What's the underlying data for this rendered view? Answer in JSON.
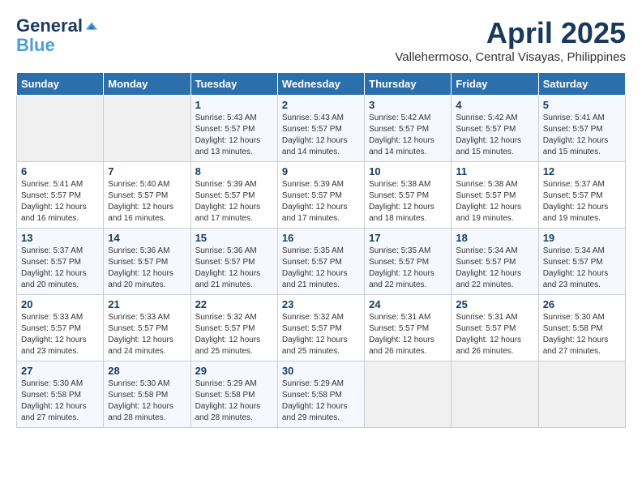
{
  "header": {
    "logo_line1": "General",
    "logo_line2": "Blue",
    "month_title": "April 2025",
    "subtitle": "Vallehermoso, Central Visayas, Philippines"
  },
  "days_of_week": [
    "Sunday",
    "Monday",
    "Tuesday",
    "Wednesday",
    "Thursday",
    "Friday",
    "Saturday"
  ],
  "weeks": [
    [
      {
        "day": "",
        "sunrise": "",
        "sunset": "",
        "daylight": ""
      },
      {
        "day": "",
        "sunrise": "",
        "sunset": "",
        "daylight": ""
      },
      {
        "day": "1",
        "sunrise": "Sunrise: 5:43 AM",
        "sunset": "Sunset: 5:57 PM",
        "daylight": "Daylight: 12 hours and 13 minutes."
      },
      {
        "day": "2",
        "sunrise": "Sunrise: 5:43 AM",
        "sunset": "Sunset: 5:57 PM",
        "daylight": "Daylight: 12 hours and 14 minutes."
      },
      {
        "day": "3",
        "sunrise": "Sunrise: 5:42 AM",
        "sunset": "Sunset: 5:57 PM",
        "daylight": "Daylight: 12 hours and 14 minutes."
      },
      {
        "day": "4",
        "sunrise": "Sunrise: 5:42 AM",
        "sunset": "Sunset: 5:57 PM",
        "daylight": "Daylight: 12 hours and 15 minutes."
      },
      {
        "day": "5",
        "sunrise": "Sunrise: 5:41 AM",
        "sunset": "Sunset: 5:57 PM",
        "daylight": "Daylight: 12 hours and 15 minutes."
      }
    ],
    [
      {
        "day": "6",
        "sunrise": "Sunrise: 5:41 AM",
        "sunset": "Sunset: 5:57 PM",
        "daylight": "Daylight: 12 hours and 16 minutes."
      },
      {
        "day": "7",
        "sunrise": "Sunrise: 5:40 AM",
        "sunset": "Sunset: 5:57 PM",
        "daylight": "Daylight: 12 hours and 16 minutes."
      },
      {
        "day": "8",
        "sunrise": "Sunrise: 5:39 AM",
        "sunset": "Sunset: 5:57 PM",
        "daylight": "Daylight: 12 hours and 17 minutes."
      },
      {
        "day": "9",
        "sunrise": "Sunrise: 5:39 AM",
        "sunset": "Sunset: 5:57 PM",
        "daylight": "Daylight: 12 hours and 17 minutes."
      },
      {
        "day": "10",
        "sunrise": "Sunrise: 5:38 AM",
        "sunset": "Sunset: 5:57 PM",
        "daylight": "Daylight: 12 hours and 18 minutes."
      },
      {
        "day": "11",
        "sunrise": "Sunrise: 5:38 AM",
        "sunset": "Sunset: 5:57 PM",
        "daylight": "Daylight: 12 hours and 19 minutes."
      },
      {
        "day": "12",
        "sunrise": "Sunrise: 5:37 AM",
        "sunset": "Sunset: 5:57 PM",
        "daylight": "Daylight: 12 hours and 19 minutes."
      }
    ],
    [
      {
        "day": "13",
        "sunrise": "Sunrise: 5:37 AM",
        "sunset": "Sunset: 5:57 PM",
        "daylight": "Daylight: 12 hours and 20 minutes."
      },
      {
        "day": "14",
        "sunrise": "Sunrise: 5:36 AM",
        "sunset": "Sunset: 5:57 PM",
        "daylight": "Daylight: 12 hours and 20 minutes."
      },
      {
        "day": "15",
        "sunrise": "Sunrise: 5:36 AM",
        "sunset": "Sunset: 5:57 PM",
        "daylight": "Daylight: 12 hours and 21 minutes."
      },
      {
        "day": "16",
        "sunrise": "Sunrise: 5:35 AM",
        "sunset": "Sunset: 5:57 PM",
        "daylight": "Daylight: 12 hours and 21 minutes."
      },
      {
        "day": "17",
        "sunrise": "Sunrise: 5:35 AM",
        "sunset": "Sunset: 5:57 PM",
        "daylight": "Daylight: 12 hours and 22 minutes."
      },
      {
        "day": "18",
        "sunrise": "Sunrise: 5:34 AM",
        "sunset": "Sunset: 5:57 PM",
        "daylight": "Daylight: 12 hours and 22 minutes."
      },
      {
        "day": "19",
        "sunrise": "Sunrise: 5:34 AM",
        "sunset": "Sunset: 5:57 PM",
        "daylight": "Daylight: 12 hours and 23 minutes."
      }
    ],
    [
      {
        "day": "20",
        "sunrise": "Sunrise: 5:33 AM",
        "sunset": "Sunset: 5:57 PM",
        "daylight": "Daylight: 12 hours and 23 minutes."
      },
      {
        "day": "21",
        "sunrise": "Sunrise: 5:33 AM",
        "sunset": "Sunset: 5:57 PM",
        "daylight": "Daylight: 12 hours and 24 minutes."
      },
      {
        "day": "22",
        "sunrise": "Sunrise: 5:32 AM",
        "sunset": "Sunset: 5:57 PM",
        "daylight": "Daylight: 12 hours and 25 minutes."
      },
      {
        "day": "23",
        "sunrise": "Sunrise: 5:32 AM",
        "sunset": "Sunset: 5:57 PM",
        "daylight": "Daylight: 12 hours and 25 minutes."
      },
      {
        "day": "24",
        "sunrise": "Sunrise: 5:31 AM",
        "sunset": "Sunset: 5:57 PM",
        "daylight": "Daylight: 12 hours and 26 minutes."
      },
      {
        "day": "25",
        "sunrise": "Sunrise: 5:31 AM",
        "sunset": "Sunset: 5:57 PM",
        "daylight": "Daylight: 12 hours and 26 minutes."
      },
      {
        "day": "26",
        "sunrise": "Sunrise: 5:30 AM",
        "sunset": "Sunset: 5:58 PM",
        "daylight": "Daylight: 12 hours and 27 minutes."
      }
    ],
    [
      {
        "day": "27",
        "sunrise": "Sunrise: 5:30 AM",
        "sunset": "Sunset: 5:58 PM",
        "daylight": "Daylight: 12 hours and 27 minutes."
      },
      {
        "day": "28",
        "sunrise": "Sunrise: 5:30 AM",
        "sunset": "Sunset: 5:58 PM",
        "daylight": "Daylight: 12 hours and 28 minutes."
      },
      {
        "day": "29",
        "sunrise": "Sunrise: 5:29 AM",
        "sunset": "Sunset: 5:58 PM",
        "daylight": "Daylight: 12 hours and 28 minutes."
      },
      {
        "day": "30",
        "sunrise": "Sunrise: 5:29 AM",
        "sunset": "Sunset: 5:58 PM",
        "daylight": "Daylight: 12 hours and 29 minutes."
      },
      {
        "day": "",
        "sunrise": "",
        "sunset": "",
        "daylight": ""
      },
      {
        "day": "",
        "sunrise": "",
        "sunset": "",
        "daylight": ""
      },
      {
        "day": "",
        "sunrise": "",
        "sunset": "",
        "daylight": ""
      }
    ]
  ]
}
